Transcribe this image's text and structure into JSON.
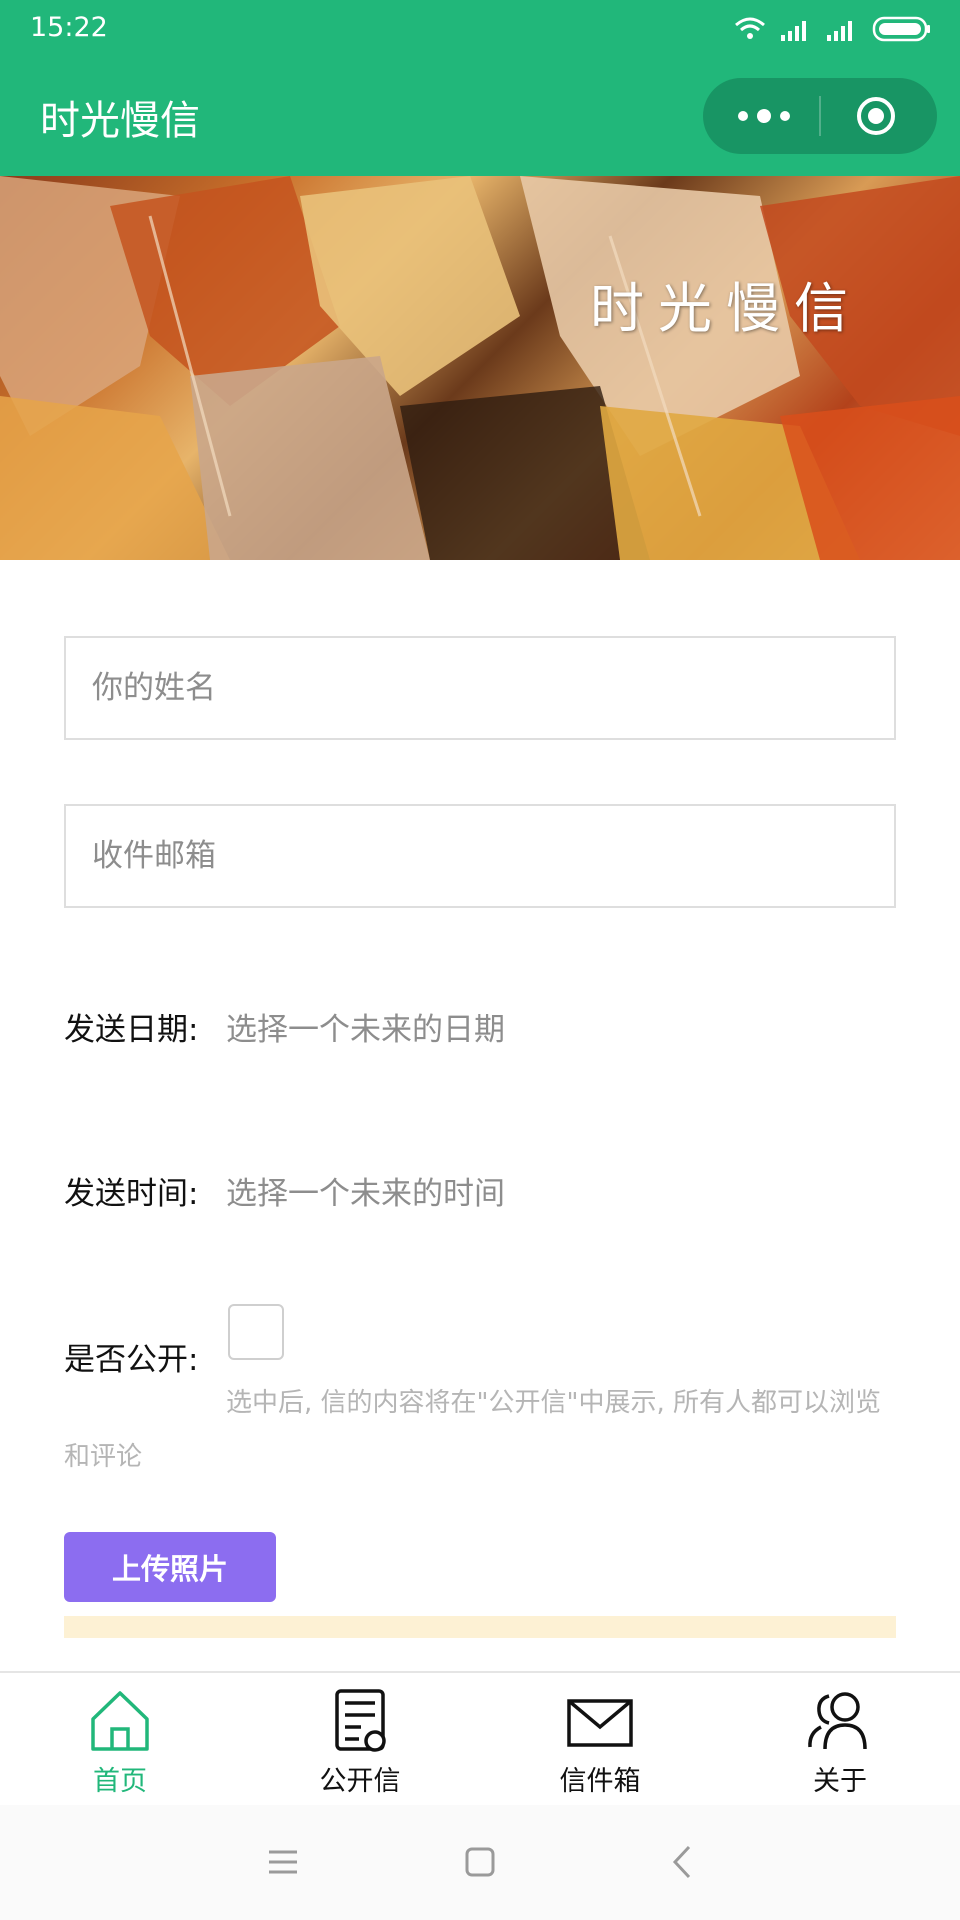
{
  "status_bar": {
    "time": "15:22"
  },
  "header": {
    "title": "时光慢信"
  },
  "banner": {
    "slogan": "时光慢信"
  },
  "form": {
    "name_placeholder": "你的姓名",
    "email_placeholder": "收件邮箱",
    "date_label": "发送日期:",
    "date_value": "选择一个未来的日期",
    "time_label": "发送时间:",
    "time_value": "选择一个未来的时间",
    "public_label": "是否公开:",
    "public_checked": false,
    "public_note": "选中后, 信的内容将在\"公开信\"中展示, 所有人都可以浏览和评论",
    "upload_label": "上传照片"
  },
  "tabbar": {
    "items": [
      {
        "label": "首页",
        "icon": "home-icon",
        "active": true
      },
      {
        "label": "公开信",
        "icon": "document-icon",
        "active": false
      },
      {
        "label": "信件箱",
        "icon": "envelope-icon",
        "active": false
      },
      {
        "label": "关于",
        "icon": "users-icon",
        "active": false
      }
    ]
  },
  "colors": {
    "primary": "#21b77a",
    "upload_button": "#8c6df0",
    "tip_bar": "#fdf1d4"
  }
}
